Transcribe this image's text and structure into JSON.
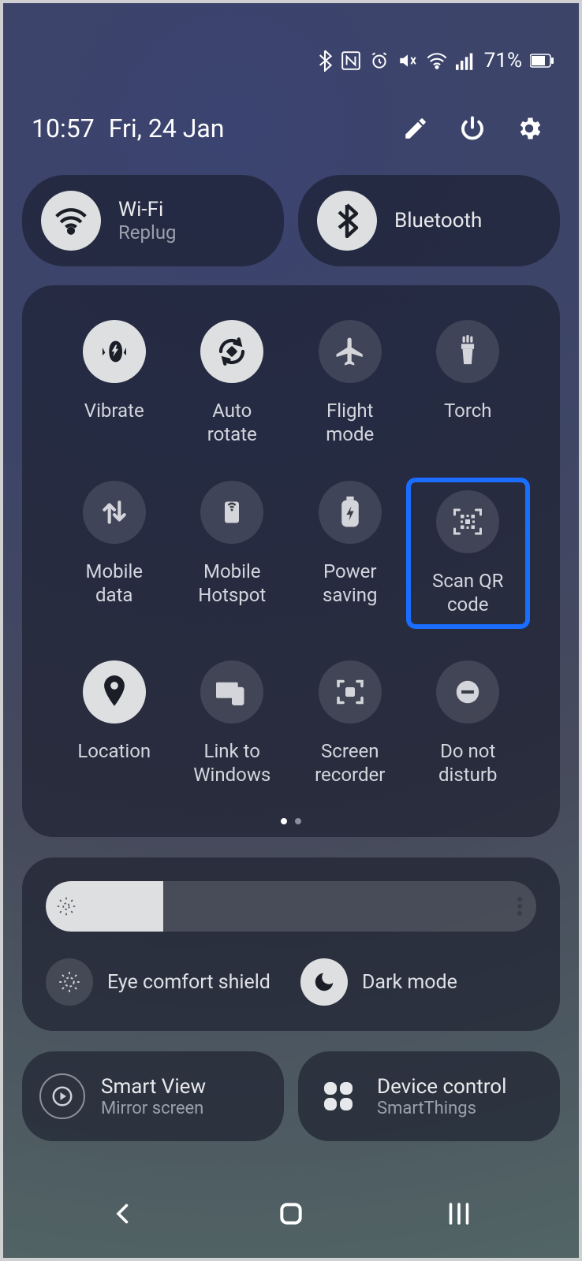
{
  "status": {
    "battery_text": "71%"
  },
  "header": {
    "time": "10:57",
    "date": "Fri, 24 Jan"
  },
  "top": {
    "wifi": {
      "title": "Wi-Fi",
      "sub": "Replug"
    },
    "bt": {
      "title": "Bluetooth"
    }
  },
  "grid": [
    {
      "id": "vibrate",
      "label": "Vibrate",
      "on": true
    },
    {
      "id": "autorotate",
      "label": "Auto\nrotate",
      "on": true
    },
    {
      "id": "flight",
      "label": "Flight\nmode",
      "on": false
    },
    {
      "id": "torch",
      "label": "Torch",
      "on": false
    },
    {
      "id": "mobiledata",
      "label": "Mobile\ndata",
      "on": false
    },
    {
      "id": "hotspot",
      "label": "Mobile\nHotspot",
      "on": false
    },
    {
      "id": "power",
      "label": "Power\nsaving",
      "on": false
    },
    {
      "id": "qr",
      "label": "Scan QR\ncode",
      "on": false,
      "highlight": true
    },
    {
      "id": "location",
      "label": "Location",
      "on": true
    },
    {
      "id": "linkwin",
      "label": "Link to\nWindows",
      "on": false
    },
    {
      "id": "screenrec",
      "label": "Screen\nrecorder",
      "on": false
    },
    {
      "id": "dnd",
      "label": "Do not\ndisturb",
      "on": false
    }
  ],
  "brightness": {
    "percent": 24
  },
  "modes": {
    "eye": {
      "label": "Eye comfort shield",
      "on": false
    },
    "dark": {
      "label": "Dark mode",
      "on": true
    }
  },
  "pair": {
    "smartview": {
      "title": "Smart View",
      "sub": "Mirror screen"
    },
    "devicecontrol": {
      "title": "Device control",
      "sub": "SmartThings"
    }
  }
}
